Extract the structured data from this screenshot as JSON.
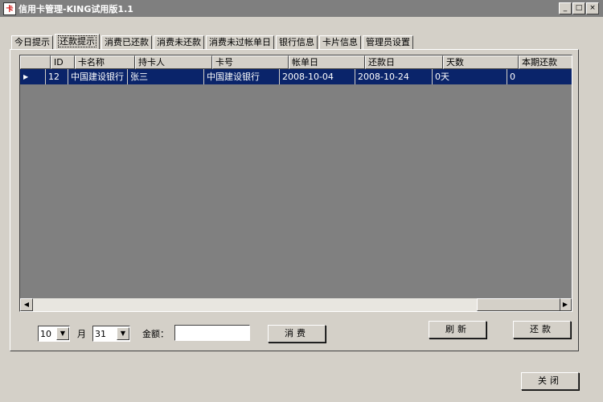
{
  "window": {
    "title": "信用卡管理-KING试用版1.1",
    "minimize": "_",
    "maximize": "□",
    "close": "×"
  },
  "tabs": [
    {
      "label": "今日提示"
    },
    {
      "label": "还款提示"
    },
    {
      "label": "消费已还款"
    },
    {
      "label": "消费未还款"
    },
    {
      "label": "消费未过帐单日"
    },
    {
      "label": "银行信息"
    },
    {
      "label": "卡片信息"
    },
    {
      "label": "管理员设置"
    }
  ],
  "active_tab": "还款提示",
  "grid": {
    "columns": [
      "ID",
      "卡名称",
      "持卡人",
      "卡号",
      "帐单日",
      "还款日",
      "天数",
      "本期还款"
    ],
    "rows": [
      {
        "cells": [
          "12",
          "中国建设银行",
          "张三",
          "中国建设银行",
          "2008-10-04",
          "2008-10-24",
          "0天",
          "0"
        ]
      }
    ]
  },
  "filters": {
    "month_value": "10",
    "month_label": "月",
    "day_value": "31",
    "amount_label": "金额：",
    "amount_value": ""
  },
  "buttons": {
    "consume": "消费",
    "refresh": "刷新",
    "repay": "还款",
    "close": "关闭"
  }
}
